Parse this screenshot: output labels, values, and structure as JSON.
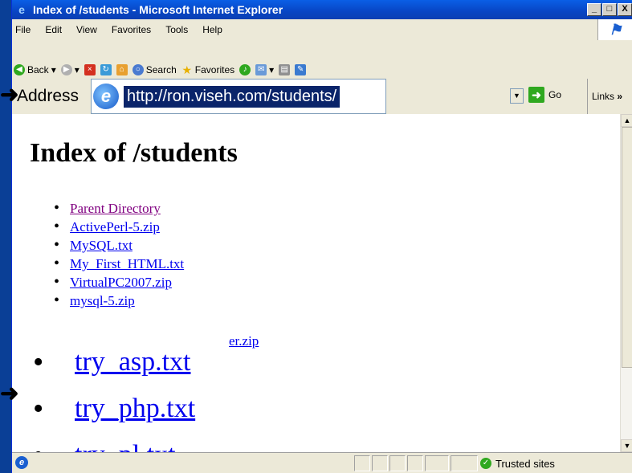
{
  "window": {
    "title": "Index of /students - Microsoft Internet Explorer",
    "minimize": "_",
    "maximize": "□",
    "close": "X"
  },
  "menu": [
    "File",
    "Edit",
    "View",
    "Favorites",
    "Tools",
    "Help"
  ],
  "toolbar": {
    "back": "Back",
    "search": "Search",
    "favorites": "Favorites"
  },
  "address": {
    "label": "Address",
    "url": "http://ron.viseh.com/students/",
    "go": "Go",
    "links": "Links"
  },
  "page": {
    "title": "Index of /students",
    "files": [
      "Parent Directory",
      "ActivePerl-5.zip",
      "MySQL.txt",
      "My_First_HTML.txt",
      "VirtualPC2007.zip",
      "mysql-5.zip"
    ],
    "fragment_link": "er.zip",
    "big_files": [
      "try_asp.txt",
      "try_php.txt",
      "try_pl.txt"
    ]
  },
  "status": {
    "zone": "Trusted sites"
  },
  "colors": {
    "link": "#0000ee",
    "visited": "#800080",
    "titlebar": "#0845c4",
    "desktop": "#0a4fa8"
  }
}
